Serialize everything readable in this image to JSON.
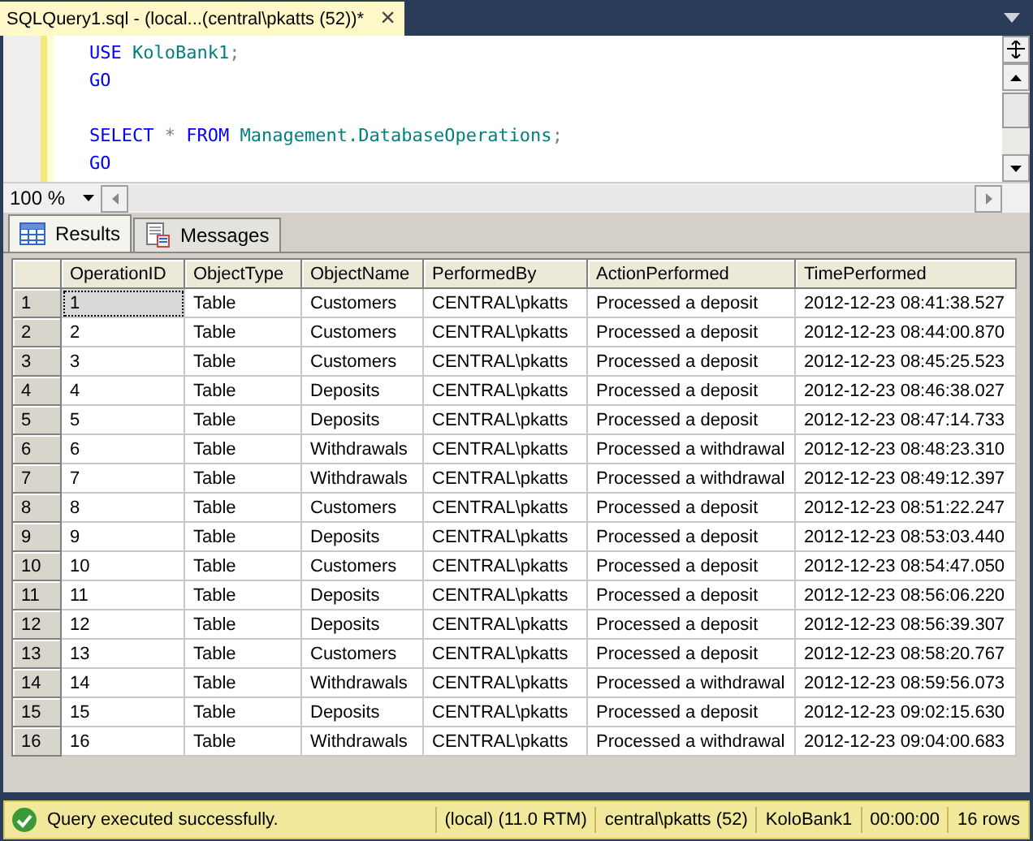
{
  "document_tab": {
    "title": "SQLQuery1.sql - (local...(central\\pkatts (52))*",
    "close": "×",
    "selected": true
  },
  "editor": {
    "lines": [
      {
        "kind": "code",
        "tokens": [
          {
            "kind": "keyword",
            "text": "USE"
          },
          {
            "kind": "identifier",
            "text": "KoloBank1"
          },
          {
            "kind": "terminator",
            "text": ";"
          }
        ]
      },
      {
        "kind": "code",
        "tokens": [
          {
            "kind": "keyword",
            "text": "GO"
          }
        ]
      },
      {
        "kind": "blank"
      },
      {
        "kind": "code",
        "tokens": [
          {
            "kind": "keyword",
            "text": "SELECT"
          },
          {
            "kind": "operator",
            "text": "*"
          },
          {
            "kind": "keyword",
            "text": "FROM"
          },
          {
            "kind": "identifier",
            "text": "Management.DatabaseOperations"
          },
          {
            "kind": "terminator",
            "text": ";"
          }
        ]
      },
      {
        "kind": "code",
        "tokens": [
          {
            "kind": "keyword",
            "text": "GO"
          }
        ]
      }
    ],
    "zoom": "100 %"
  },
  "result_tabs": [
    {
      "label": "Results",
      "selected": true,
      "kind": "grid"
    },
    {
      "label": "Messages",
      "selected": false,
      "kind": "messages"
    }
  ],
  "table": {
    "columns": [
      "OperationID",
      "ObjectType",
      "ObjectName",
      "PerformedBy",
      "ActionPerformed",
      "TimePerformed"
    ],
    "rows": [
      {
        "number": "1",
        "focused": true,
        "cells": [
          "1",
          "Table",
          "Customers",
          "CENTRAL\\pkatts",
          "Processed a deposit",
          "2012-12-23 08:41:38.527"
        ]
      },
      {
        "number": "2",
        "focused": false,
        "cells": [
          "2",
          "Table",
          "Customers",
          "CENTRAL\\pkatts",
          "Processed a deposit",
          "2012-12-23 08:44:00.870"
        ]
      },
      {
        "number": "3",
        "focused": false,
        "cells": [
          "3",
          "Table",
          "Customers",
          "CENTRAL\\pkatts",
          "Processed a deposit",
          "2012-12-23 08:45:25.523"
        ]
      },
      {
        "number": "4",
        "focused": false,
        "cells": [
          "4",
          "Table",
          "Deposits",
          "CENTRAL\\pkatts",
          "Processed a deposit",
          "2012-12-23 08:46:38.027"
        ]
      },
      {
        "number": "5",
        "focused": false,
        "cells": [
          "5",
          "Table",
          "Deposits",
          "CENTRAL\\pkatts",
          "Processed a deposit",
          "2012-12-23 08:47:14.733"
        ]
      },
      {
        "number": "6",
        "focused": false,
        "cells": [
          "6",
          "Table",
          "Withdrawals",
          "CENTRAL\\pkatts",
          "Processed a withdrawal",
          "2012-12-23 08:48:23.310"
        ]
      },
      {
        "number": "7",
        "focused": false,
        "cells": [
          "7",
          "Table",
          "Withdrawals",
          "CENTRAL\\pkatts",
          "Processed a withdrawal",
          "2012-12-23 08:49:12.397"
        ]
      },
      {
        "number": "8",
        "focused": false,
        "cells": [
          "8",
          "Table",
          "Customers",
          "CENTRAL\\pkatts",
          "Processed a deposit",
          "2012-12-23 08:51:22.247"
        ]
      },
      {
        "number": "9",
        "focused": false,
        "cells": [
          "9",
          "Table",
          "Deposits",
          "CENTRAL\\pkatts",
          "Processed a deposit",
          "2012-12-23 08:53:03.440"
        ]
      },
      {
        "number": "10",
        "focused": false,
        "cells": [
          "10",
          "Table",
          "Customers",
          "CENTRAL\\pkatts",
          "Processed a deposit",
          "2012-12-23 08:54:47.050"
        ]
      },
      {
        "number": "11",
        "focused": false,
        "cells": [
          "11",
          "Table",
          "Deposits",
          "CENTRAL\\pkatts",
          "Processed a deposit",
          "2012-12-23 08:56:06.220"
        ]
      },
      {
        "number": "12",
        "focused": false,
        "cells": [
          "12",
          "Table",
          "Deposits",
          "CENTRAL\\pkatts",
          "Processed a deposit",
          "2012-12-23 08:56:39.307"
        ]
      },
      {
        "number": "13",
        "focused": false,
        "cells": [
          "13",
          "Table",
          "Customers",
          "CENTRAL\\pkatts",
          "Processed a deposit",
          "2012-12-23 08:58:20.767"
        ]
      },
      {
        "number": "14",
        "focused": false,
        "cells": [
          "14",
          "Table",
          "Withdrawals",
          "CENTRAL\\pkatts",
          "Processed a withdrawal",
          "2012-12-23 08:59:56.073"
        ]
      },
      {
        "number": "15",
        "focused": false,
        "cells": [
          "15",
          "Table",
          "Deposits",
          "CENTRAL\\pkatts",
          "Processed a deposit",
          "2012-12-23 09:02:15.630"
        ]
      },
      {
        "number": "16",
        "focused": false,
        "cells": [
          "16",
          "Table",
          "Withdrawals",
          "CENTRAL\\pkatts",
          "Processed a withdrawal",
          "2012-12-23 09:04:00.683"
        ]
      }
    ]
  },
  "status_bar": {
    "message": "Query executed successfully.",
    "segments": [
      "(local) (11.0 RTM)",
      "central\\pkatts (52)",
      "KoloBank1",
      "00:00:00",
      "16 rows"
    ]
  }
}
